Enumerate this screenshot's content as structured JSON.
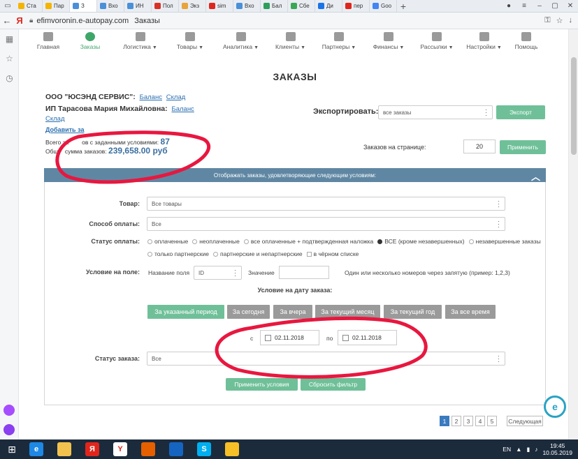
{
  "browser": {
    "tabs": [
      {
        "label": "Ста",
        "color": "#f4b400"
      },
      {
        "label": "Пар",
        "color": "#f4b400"
      },
      {
        "label": "З",
        "color": "#4a90d9",
        "active": true
      },
      {
        "label": "Вхо",
        "color": "#4a90d9"
      },
      {
        "label": "ИН",
        "color": "#4a90d9"
      },
      {
        "label": "Пол",
        "color": "#d93025"
      },
      {
        "label": "Экз",
        "color": "#e8a33c"
      },
      {
        "label": "sim",
        "color": "#e0261c"
      },
      {
        "label": "Вхо",
        "color": "#4a90d9"
      },
      {
        "label": "Бал",
        "color": "#2e9e5b"
      },
      {
        "label": "Сбе",
        "color": "#3aa757"
      },
      {
        "label": "Ди",
        "color": "#1a73e8"
      },
      {
        "label": "пер",
        "color": "#e0261c"
      },
      {
        "label": "Goo",
        "color": "#4285f4"
      }
    ],
    "new_tab": "+",
    "back": "←",
    "yandex_logo": "Я",
    "url_domain": "efimvoronin.e-autopay.com",
    "url_title": "Заказы"
  },
  "nav": [
    {
      "label": "Главная",
      "icon": "home-icon",
      "dropdown": false
    },
    {
      "label": "Заказы",
      "icon": "orders-icon",
      "dropdown": false,
      "active": true
    },
    {
      "label": "Логистика",
      "icon": "logistics-icon",
      "dropdown": true
    },
    {
      "label": "Товары",
      "icon": "products-icon",
      "dropdown": true
    },
    {
      "label": "Аналитика",
      "icon": "analytics-icon",
      "dropdown": true
    },
    {
      "label": "Клиенты",
      "icon": "clients-icon",
      "dropdown": true
    },
    {
      "label": "Партнеры",
      "icon": "partners-icon",
      "dropdown": true
    },
    {
      "label": "Финансы",
      "icon": "finance-icon",
      "dropdown": true
    },
    {
      "label": "Рассылки",
      "icon": "mail-icon",
      "dropdown": true
    },
    {
      "label": "Настройки",
      "icon": "gear-icon",
      "dropdown": true
    },
    {
      "label": "Помощь",
      "icon": "help-icon",
      "dropdown": false
    }
  ],
  "page": {
    "title": "ЗАКАЗЫ",
    "company1": "ООО \"ЮСЭНД СЕРВИС\":",
    "company1_balance": "Баланс",
    "company1_stock": "Склад",
    "company2": "ИП Тарасова Мария Михайловна:",
    "company2_balance": "Баланс",
    "company2_stock": "Склад",
    "add_client": "Добавить за",
    "orders_count_label": "Всего за        ов с заданными условиями:",
    "orders_count": "87",
    "orders_sum_label": "Общ    сумма заказов:",
    "orders_sum": "239,658.00 руб",
    "export_label": "Экспортировать:",
    "export_value": "все заказы",
    "export_button": "Экспорт",
    "per_page_label": "Заказов на странице:",
    "per_page_value": "20",
    "apply_button": "Применить"
  },
  "filter": {
    "header": "Отображать заказы, удовлетворяющие следующим условиям:",
    "product_label": "Товар:",
    "product_value": "Все товары",
    "payment_method_label": "Способ оплаты:",
    "payment_method_value": "Все",
    "payment_status_label": "Статус оплаты:",
    "payment_status_options": [
      {
        "label": "оплаченные",
        "checked": false,
        "kind": "radio"
      },
      {
        "label": "неоплаченные",
        "checked": false,
        "kind": "radio"
      },
      {
        "label": "все оплаченные + подтвержденная наложка",
        "checked": false,
        "kind": "radio"
      },
      {
        "label": "ВСЕ (кроме незавершенных)",
        "checked": true,
        "kind": "radio"
      },
      {
        "label": "незавершенные заказы",
        "checked": false,
        "kind": "radio"
      },
      {
        "label": "только партнерские",
        "checked": false,
        "kind": "radio"
      },
      {
        "label": "партнерские и непартнерские",
        "checked": false,
        "kind": "radio"
      },
      {
        "label": "в чёрном списке",
        "checked": false,
        "kind": "checkbox"
      }
    ],
    "field_condition_label": "Условие на поле:",
    "field_name_label": "Название поля",
    "field_name_value": "ID",
    "value_label": "Значение",
    "value_value": "",
    "hint": "Один или несколько номеров через запятую (пример: 1,2,3)",
    "date_condition_label": "Условие на дату заказа:",
    "period_buttons": [
      {
        "label": "За указанный период",
        "active": true
      },
      {
        "label": "За сегодня",
        "active": false
      },
      {
        "label": "За вчера",
        "active": false
      },
      {
        "label": "За текущий месяц",
        "active": false
      },
      {
        "label": "За текущий год",
        "active": false
      },
      {
        "label": "За все время",
        "active": false
      }
    ],
    "from_label": "с",
    "from_date": "02.11.2018",
    "to_label": "по",
    "to_date": "02.11.2018",
    "order_status_label": "Статус заказа:",
    "order_status_value": "Все",
    "apply_conditions": "Применить условия",
    "reset_filter": "Сбросить фильтр"
  },
  "pagination": {
    "pages": [
      "1",
      "2",
      "3",
      "4",
      "5"
    ],
    "active": "1",
    "next": "Следующая"
  },
  "taskbar": {
    "lang": "EN",
    "time": "19:45",
    "date": "10.05.2019",
    "apps": [
      {
        "name": "ie-icon",
        "color": "#1e88e5",
        "glyph": "e"
      },
      {
        "name": "explorer-icon",
        "color": "#f2c24f",
        "glyph": ""
      },
      {
        "name": "yandex-app-icon",
        "color": "#e0261c",
        "glyph": "Я"
      },
      {
        "name": "yandex-browser-icon",
        "color": "#ffffff",
        "glyph": "Y"
      },
      {
        "name": "firefox-icon",
        "color": "#e66000",
        "glyph": ""
      },
      {
        "name": "store-icon",
        "color": "#1565c0",
        "glyph": ""
      },
      {
        "name": "skype-icon",
        "color": "#00aff0",
        "glyph": "S"
      },
      {
        "name": "app-icon",
        "color": "#f6c026",
        "glyph": ""
      }
    ]
  },
  "colors": {
    "accent_green": "#6fc098",
    "filter_header": "#5f87a3",
    "link": "#2a6fb0",
    "marker": "#e8173f"
  }
}
